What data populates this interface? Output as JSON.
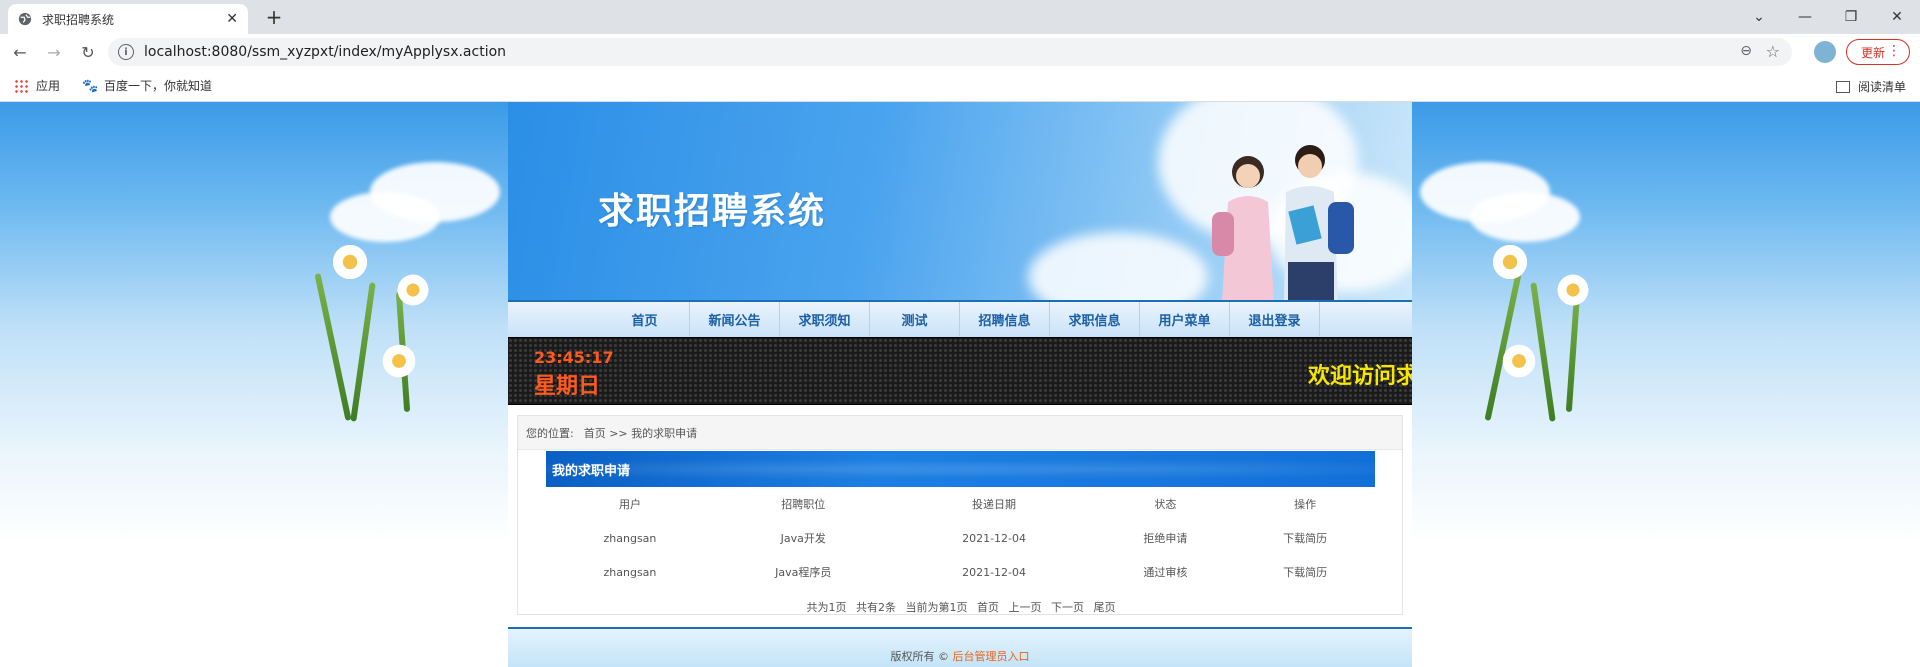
{
  "browser": {
    "tab_title": "求职招聘系统",
    "url": "localhost:8080/ssm_xyzpxt/index/myApplysx.action",
    "update_label": "更新",
    "bookmarks": [
      "应用",
      "百度一下，你就知道"
    ],
    "reading_list": "阅读清单"
  },
  "site": {
    "title": "求职招聘系统",
    "menu": [
      "首页",
      "新闻公告",
      "求职须知",
      "测试",
      "招聘信息",
      "求职信息",
      "用户菜单",
      "退出登录"
    ],
    "clock": {
      "time": "23:45:17",
      "weekday": "星期日"
    },
    "marquee": "欢迎访问求职招聘系统"
  },
  "breadcrumb": {
    "prefix": "您的位置:",
    "path": "首页 >> 我的求职申请"
  },
  "panel": {
    "title": "我的求职申请",
    "columns": [
      "用户",
      "招聘职位",
      "投递日期",
      "状态",
      "操作"
    ],
    "rows": [
      [
        "zhangsan",
        "Java开发",
        "2021-12-04",
        "拒绝申请",
        "下载简历"
      ],
      [
        "zhangsan",
        "Java程序员",
        "2021-12-04",
        "通过审核",
        "下载简历"
      ]
    ]
  },
  "pager": {
    "total_pages": "共为1页",
    "total_items": "共有2条",
    "current": "当前为第1页",
    "first": "首页",
    "prev": "上一页",
    "next": "下一页",
    "last": "尾页"
  },
  "footer": {
    "copyright": "版权所有 ©",
    "admin_link": "后台管理员入口"
  }
}
